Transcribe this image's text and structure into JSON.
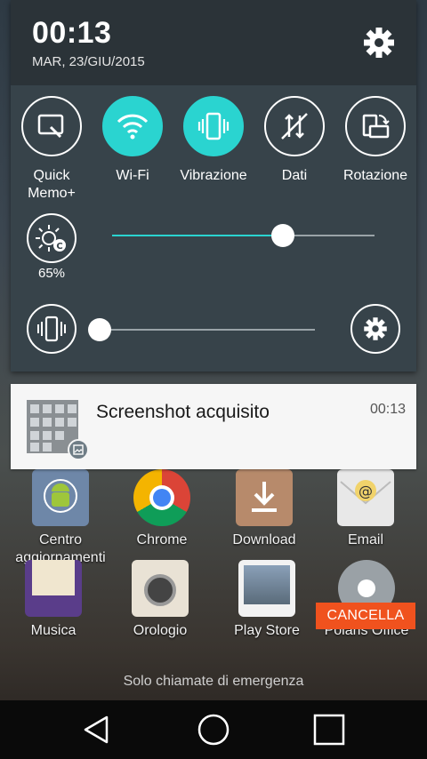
{
  "status": {
    "time": "00:13",
    "date": "MAR, 23/GIU/2015"
  },
  "quick_settings": [
    {
      "label": "Quick\nMemo+",
      "icon": "quick-memo-icon",
      "active": false
    },
    {
      "label": "Wi-Fi",
      "icon": "wifi-icon",
      "active": true
    },
    {
      "label": "Vibrazione",
      "icon": "vibration-icon",
      "active": true
    },
    {
      "label": "Dati",
      "icon": "data-off-icon",
      "active": false
    },
    {
      "label": "Rotazione",
      "icon": "rotation-icon",
      "active": false
    }
  ],
  "brightness": {
    "percent_label": "65%",
    "level": 0.65
  },
  "volume": {
    "level": 0.0
  },
  "notification": {
    "title": "Screenshot acquisito",
    "time": "00:13"
  },
  "clear_button": "CANCELLA",
  "home_apps": [
    {
      "label": "Centro\naggiornamenti",
      "icon": "android-update-icon"
    },
    {
      "label": "Chrome",
      "icon": "chrome-icon"
    },
    {
      "label": "Download",
      "icon": "download-icon"
    },
    {
      "label": "Email",
      "icon": "email-icon"
    },
    {
      "label": "Musica",
      "icon": "music-icon"
    },
    {
      "label": "Orologio",
      "icon": "clock-icon"
    },
    {
      "label": "Play Store",
      "icon": "play-store-icon"
    },
    {
      "label": "Polaris Office",
      "icon": "polaris-office-icon"
    }
  ],
  "emergency_text": "Solo chiamate di emergenza",
  "colors": {
    "accent": "#2ad4d0",
    "clear_button": "#f0521e",
    "shade": "#37434a"
  }
}
